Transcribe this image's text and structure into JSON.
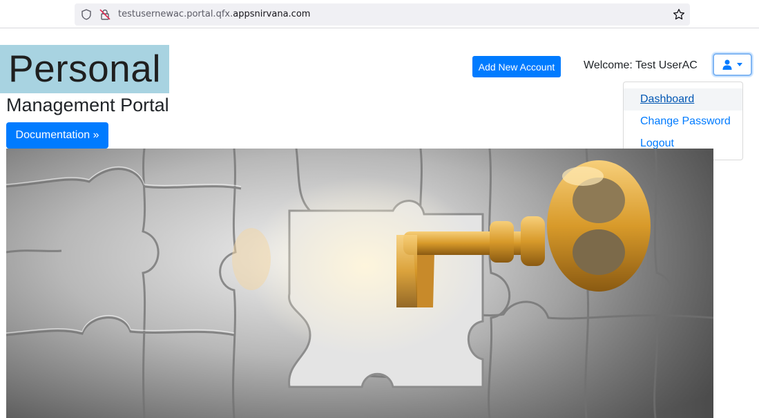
{
  "browser": {
    "url_prefix": "testusernewac.portal.qfx.",
    "url_domain": "appsnirvana.com"
  },
  "header": {
    "logo_text": "Personal",
    "subtitle": "Management Portal",
    "documentation_label": "Documentation »",
    "add_account_label": "Add New Account",
    "welcome_text": "Welcome: Test UserAC"
  },
  "user_menu": {
    "icon": "user-icon",
    "items": [
      {
        "label": "Dashboard"
      },
      {
        "label": "Change Password"
      },
      {
        "label": "Logout"
      }
    ]
  },
  "colors": {
    "primary": "#007bff",
    "logo_bg": "#a8d3e1",
    "key_gold": "#d89a2a"
  }
}
